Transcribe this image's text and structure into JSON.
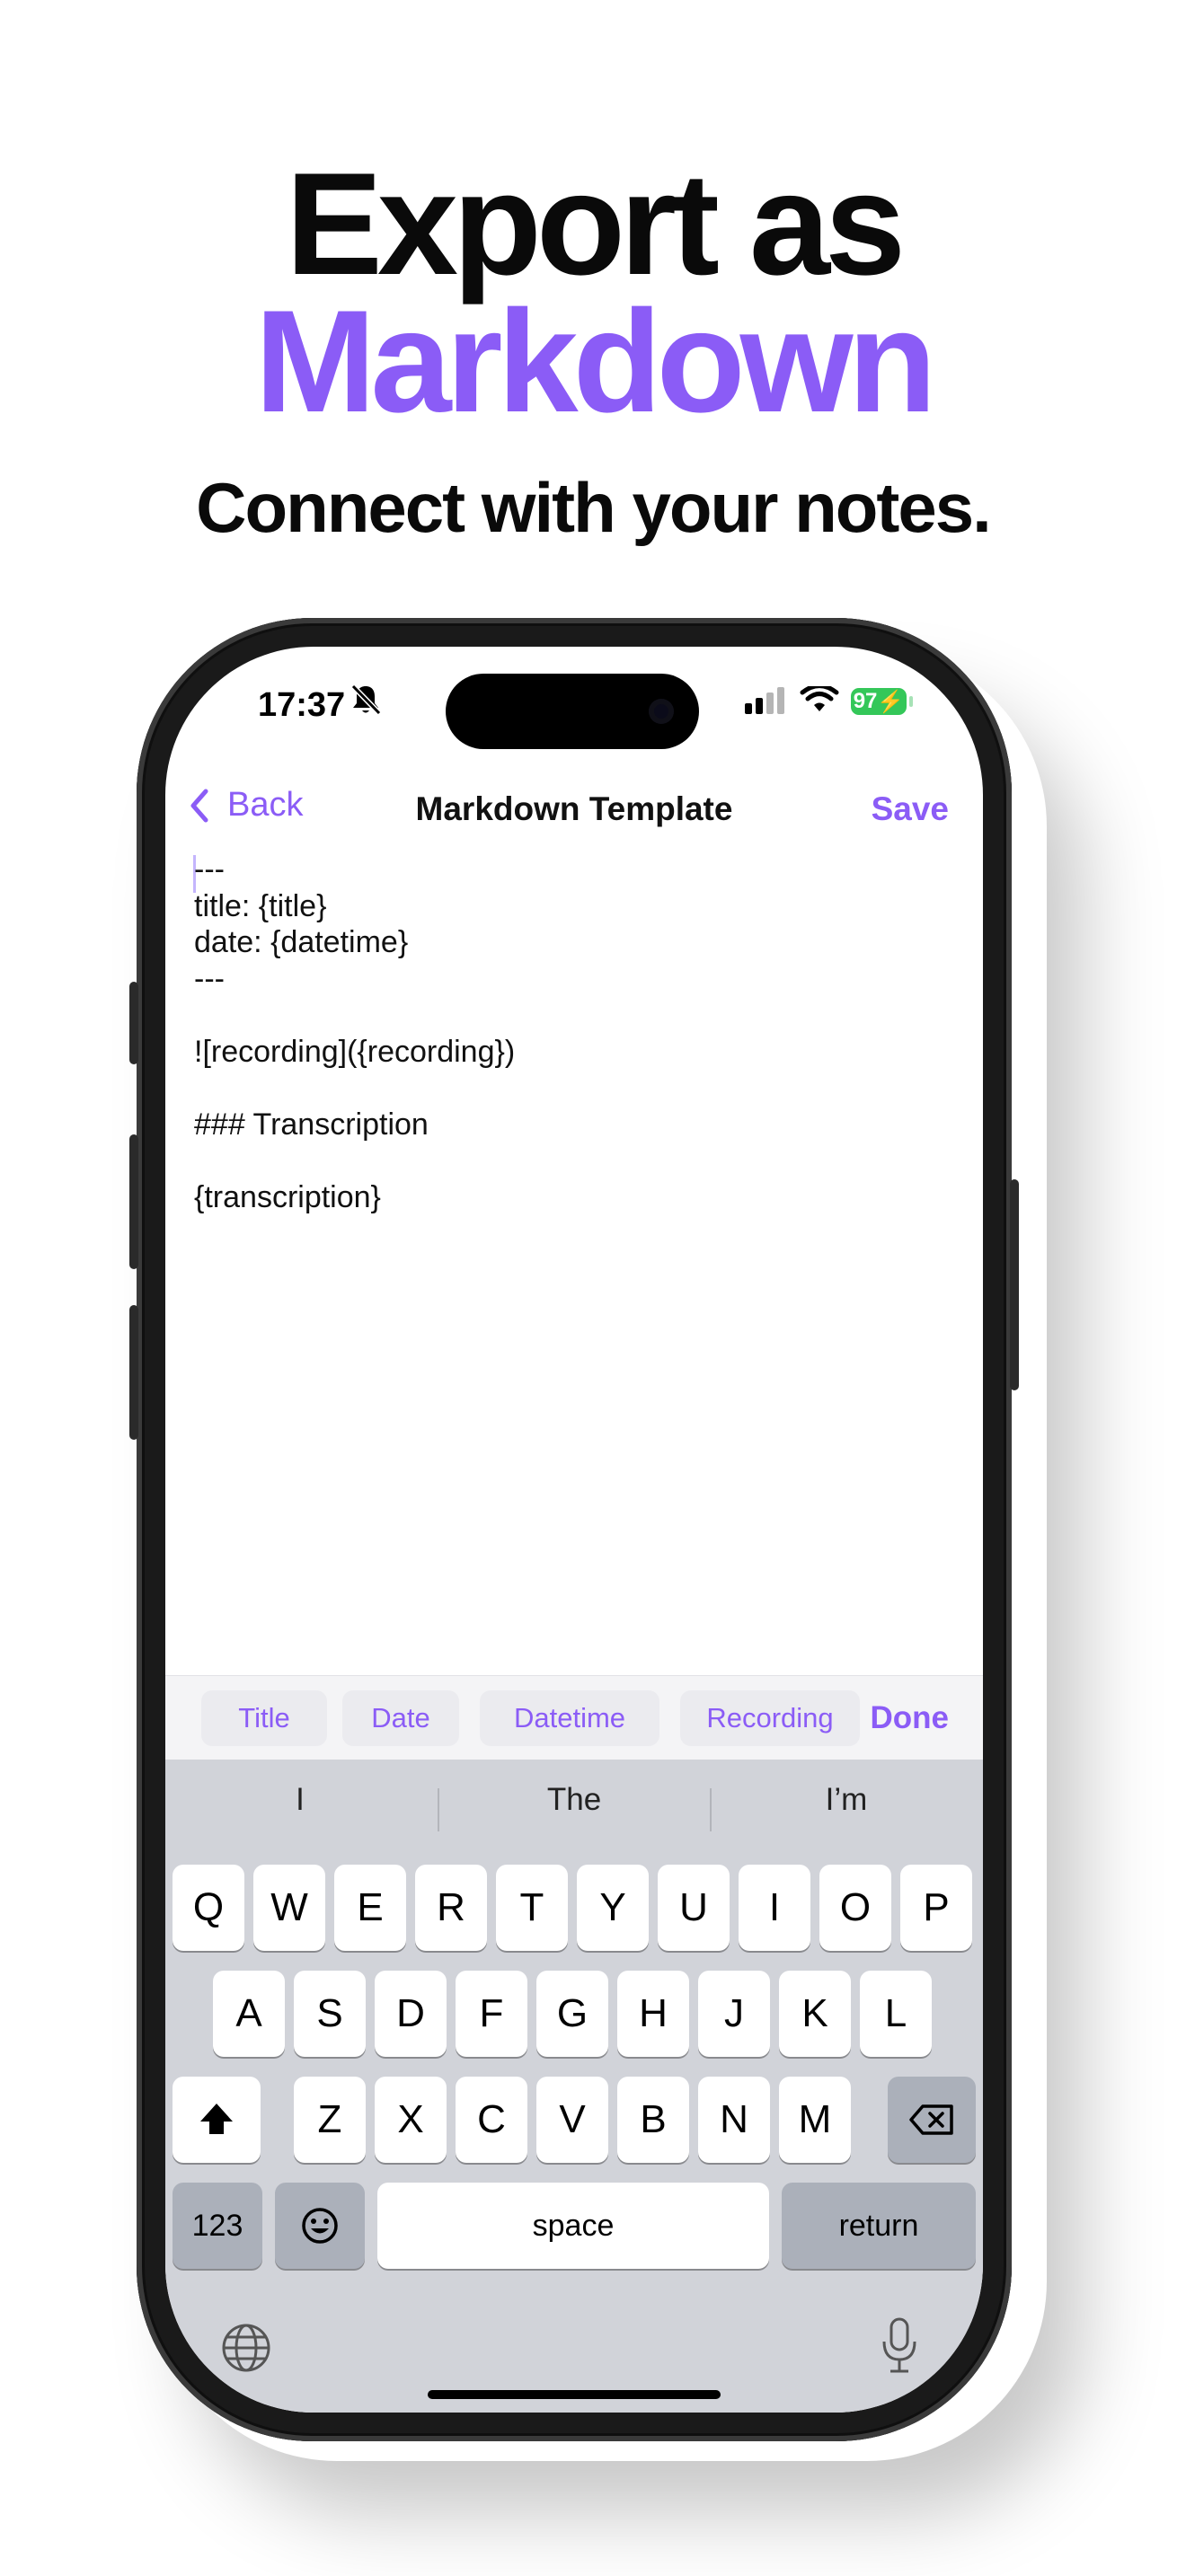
{
  "headline": {
    "line1": "Export as",
    "line2": "Markdown",
    "subtitle": "Connect with your notes."
  },
  "colors": {
    "accent": "#8b5cf6",
    "battery": "#34c759",
    "keyboard_bg": "#d1d3d9"
  },
  "status_bar": {
    "time": "17:37",
    "battery": "97",
    "icons": [
      "bell-slash-icon",
      "cellular-signal-icon",
      "wifi-icon",
      "battery-icon"
    ]
  },
  "nav": {
    "back_label": "Back",
    "title": "Markdown Template",
    "save_label": "Save"
  },
  "editor": {
    "lines": [
      "---",
      "title: {title}",
      "date: {datetime}",
      "---",
      "",
      "![recording]({recording})",
      "",
      "### Transcription",
      "",
      "{transcription}"
    ]
  },
  "tokens": {
    "items": [
      "Title",
      "Date",
      "Datetime",
      "Recording"
    ],
    "done_label": "Done"
  },
  "keyboard": {
    "suggestions": [
      "I",
      "The",
      "I’m"
    ],
    "row1": [
      "Q",
      "W",
      "E",
      "R",
      "T",
      "Y",
      "U",
      "I",
      "O",
      "P"
    ],
    "row2": [
      "A",
      "S",
      "D",
      "F",
      "G",
      "H",
      "J",
      "K",
      "L"
    ],
    "row3": [
      "Z",
      "X",
      "C",
      "V",
      "B",
      "N",
      "M"
    ],
    "numbers_label": "123",
    "space_label": "space",
    "return_label": "return"
  }
}
